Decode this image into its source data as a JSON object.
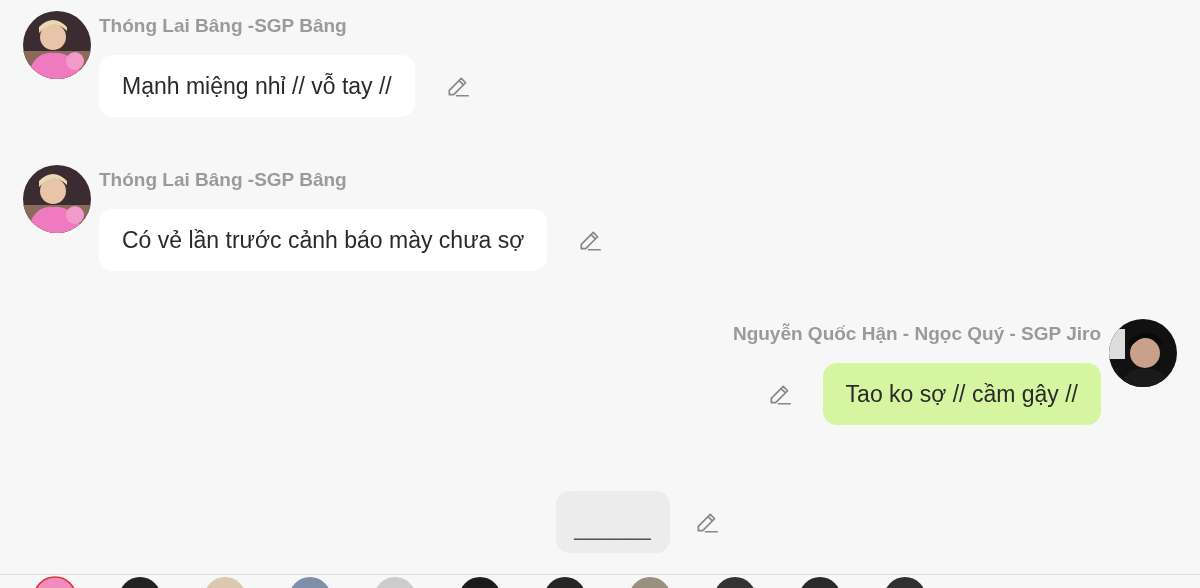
{
  "messages": [
    {
      "kind": "incoming",
      "sender": "Thóng Lai Bâng -SGP Bâng",
      "text": "Mạnh miệng nhỉ // vỗ tay //"
    },
    {
      "kind": "incoming",
      "sender": "Thóng Lai Bâng -SGP Bâng",
      "text": "Có vẻ lần trước cảnh báo mày chưa sợ"
    },
    {
      "kind": "outgoing",
      "sender": "Nguyễn Quốc Hận - Ngọc Quý - SGP Jiro",
      "text": "Tao ko sợ // cầm gậy //"
    },
    {
      "kind": "draft",
      "text": "______"
    }
  ]
}
